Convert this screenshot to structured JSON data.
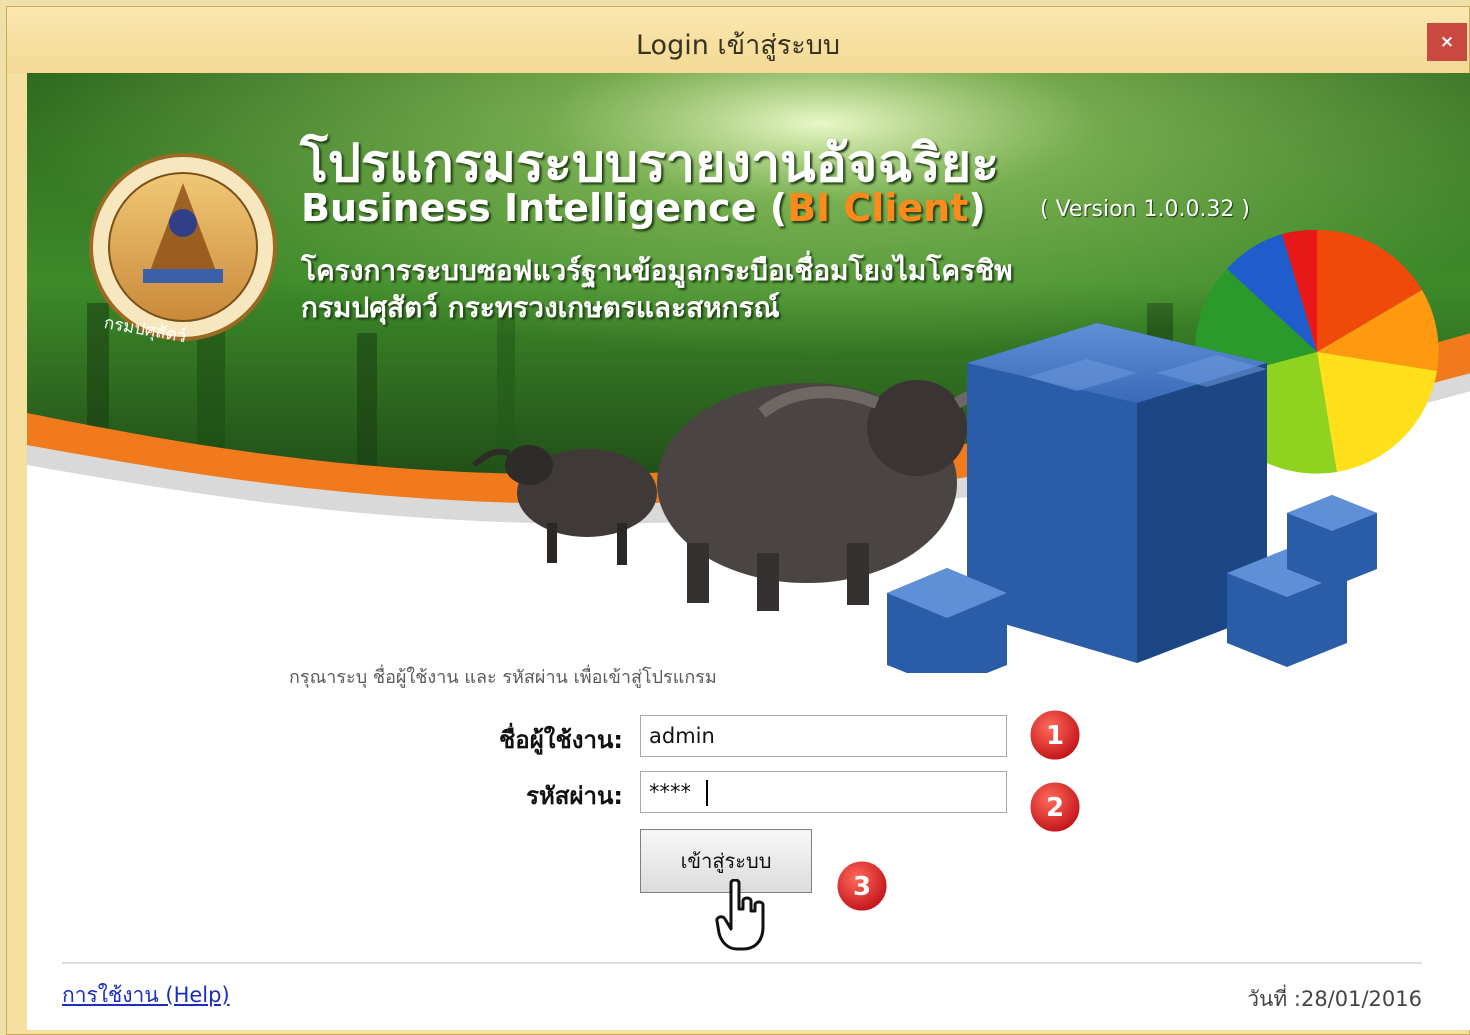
{
  "window": {
    "title": "Login เข้าสู่ระบบ",
    "close_symbol": "×"
  },
  "banner": {
    "title_thai": "โปรแกรมระบบรายงานอัจฉริยะ",
    "title_en_prefix": "Business Intelligence (",
    "title_en_highlight": "BI Client",
    "title_en_suffix": ")",
    "version": "( Version 1.0.0.32 )",
    "project_line1": "โครงการระบบซอฟแวร์ฐานข้อมูลกระบือเชื่อมโยงไมโครชิพ",
    "project_line2": "กรมปศุสัตว์  กระทรวงเกษตรและสหกรณ์",
    "logo_caption": "กรมปศุสัตว์"
  },
  "form": {
    "instruction": "กรุณาระบุ ชื่อผู้ใช้งาน และ รหัสผ่าน เพื่อเข้าสู่โปรแกรม",
    "username_label": "ชื่อผู้ใช้งาน:",
    "username_value": "admin",
    "password_label": "รหัสผ่าน:",
    "password_value": "****",
    "login_button": "เข้าสู่ระบบ",
    "step_badges": [
      "1",
      "2",
      "3"
    ]
  },
  "footer": {
    "help_link": "การใช้งาน (Help)",
    "date_label": "วันที่ :",
    "date_value": "28/01/2016"
  },
  "colors": {
    "accent_orange": "#f07a1c",
    "badge_red": "#d8232a",
    "cube_blue": "#2a5ca8",
    "forest_green": "#2f6a20"
  }
}
